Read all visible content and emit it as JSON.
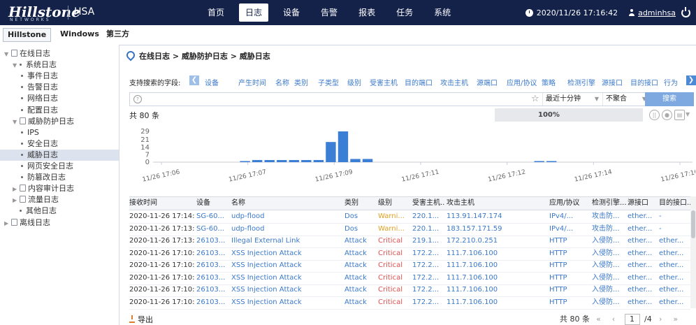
{
  "brand": {
    "logo": "Hillstone",
    "logo_sub": "NETWORKS",
    "product": "HSA"
  },
  "nav": [
    "首页",
    "日志",
    "设备",
    "告警",
    "报表",
    "任务",
    "系统"
  ],
  "nav_active": 1,
  "topright": {
    "datetime": "2020/11/26 17:16:42",
    "user": "adminhsa"
  },
  "subtabs": [
    "Hillstone",
    "Windows",
    "第三方"
  ],
  "subtab_active": 0,
  "sidebar": [
    {
      "label": "在线日志",
      "level": 0,
      "kind": "folder",
      "expanded": true
    },
    {
      "label": "系统日志",
      "level": 1,
      "kind": "dot",
      "expanded": true
    },
    {
      "label": "事件日志",
      "level": 2,
      "kind": "dot"
    },
    {
      "label": "告警日志",
      "level": 2,
      "kind": "dot"
    },
    {
      "label": "网络日志",
      "level": 2,
      "kind": "dot"
    },
    {
      "label": "配置日志",
      "level": 2,
      "kind": "dot"
    },
    {
      "label": "威胁防护日志",
      "level": 1,
      "kind": "folder",
      "expanded": true
    },
    {
      "label": "IPS",
      "level": 2,
      "kind": "dot"
    },
    {
      "label": "安全日志",
      "level": 2,
      "kind": "dot"
    },
    {
      "label": "威胁日志",
      "level": 2,
      "kind": "dot",
      "selected": true
    },
    {
      "label": "网页安全日志",
      "level": 2,
      "kind": "dot"
    },
    {
      "label": "防篡改日志",
      "level": 2,
      "kind": "dot"
    },
    {
      "label": "内容审计日志",
      "level": 1,
      "kind": "folder",
      "expanded": false
    },
    {
      "label": "流量日志",
      "level": 1,
      "kind": "folder",
      "expanded": false
    },
    {
      "label": "其他日志",
      "level": 1,
      "kind": "dot"
    },
    {
      "label": "离线日志",
      "level": 0,
      "kind": "folder",
      "expanded": false
    }
  ],
  "breadcrumb": "在线日志 > 威胁防护日志 > 威胁日志",
  "search_fields": {
    "label": "支持搜索的字段:",
    "fields": [
      "设备",
      "产生时间",
      "名称",
      "类别",
      "子类型",
      "级别",
      "受害主机",
      "目的端口",
      "攻击主机",
      "源端口",
      "应用/协议",
      "策略",
      "检测引擎",
      "源接口",
      "目的接口",
      "行为"
    ]
  },
  "search": {
    "time_range": "最近十分钟",
    "aggregate": "不聚合",
    "button": "搜索"
  },
  "total_text": "共 80 条",
  "progress_text": "100%",
  "colors": {
    "accent": "#3b79c9",
    "bar": "#3a7ed6",
    "warning": "#e0a020",
    "critical": "#e05050",
    "topbar": "#14224a"
  },
  "chart_data": {
    "type": "bar",
    "y_ticks": [
      0,
      7,
      14,
      21,
      29
    ],
    "ylim": [
      0,
      29
    ],
    "x_ticks": [
      "11/26 17:06",
      "11/26 17:07",
      "11/26 17:09",
      "11/26 17:11",
      "11/26 17:12",
      "11/26 17:14",
      "11/26 17:16"
    ],
    "values": [
      0,
      0,
      0,
      0,
      0,
      0,
      0,
      1,
      2,
      2,
      2,
      2,
      2,
      2,
      19,
      29,
      3,
      3,
      0,
      0,
      0,
      0,
      0,
      0,
      0,
      0,
      0,
      0,
      0,
      0,
      0,
      1,
      1,
      0,
      0,
      0,
      0,
      0,
      0,
      0,
      0,
      0,
      0,
      0
    ]
  },
  "table": {
    "columns": [
      "接收时间",
      "设备",
      "名称",
      "类别",
      "级别",
      "受害主机...",
      "攻击主机",
      "应用/协议",
      "检测引擎...",
      "源接口",
      "目的接口..."
    ],
    "rows": [
      [
        "2020-11-26 17:14:...",
        "SG-60...",
        "udp-flood",
        "Dos",
        "Warni...",
        "220.1...",
        "113.91.147.174",
        "IPv4/...",
        "攻击防...",
        "ether...",
        "-"
      ],
      [
        "2020-11-26 17:13:...",
        "SG-60...",
        "udp-flood",
        "Dos",
        "Warni...",
        "220.1...",
        "183.157.171.59",
        "IPv4/...",
        "攻击防...",
        "ether...",
        "-"
      ],
      [
        "2020-11-26 17:13:...",
        "26103...",
        "Illegal External Link",
        "Attack",
        "Critical",
        "219.1...",
        "172.210.0.251",
        "HTTP",
        "入侵防...",
        "ether...",
        "ether..."
      ],
      [
        "2020-11-26 17:10:...",
        "26103...",
        "XSS Injection Attack",
        "Attack",
        "Critical",
        "172.2...",
        "111.7.106.100",
        "HTTP",
        "入侵防...",
        "ether...",
        "ether..."
      ],
      [
        "2020-11-26 17:10:...",
        "26103...",
        "XSS Injection Attack",
        "Attack",
        "Critical",
        "172.2...",
        "111.7.106.100",
        "HTTP",
        "入侵防...",
        "ether...",
        "ether..."
      ],
      [
        "2020-11-26 17:10:...",
        "26103...",
        "XSS Injection Attack",
        "Attack",
        "Critical",
        "172.2...",
        "111.7.106.100",
        "HTTP",
        "入侵防...",
        "ether...",
        "ether..."
      ],
      [
        "2020-11-26 17:10:...",
        "26103...",
        "XSS Injection Attack",
        "Attack",
        "Critical",
        "172.2...",
        "111.7.106.100",
        "HTTP",
        "入侵防...",
        "ether...",
        "ether..."
      ],
      [
        "2020-11-26 17:10:...",
        "26103...",
        "XSS Injection Attack",
        "Attack",
        "Critical",
        "172.2...",
        "111.7.106.100",
        "HTTP",
        "入侵防...",
        "ether...",
        "ether..."
      ]
    ]
  },
  "footer": {
    "export": "导出",
    "total": "共 80 条",
    "page": "1",
    "pages": "/4"
  }
}
